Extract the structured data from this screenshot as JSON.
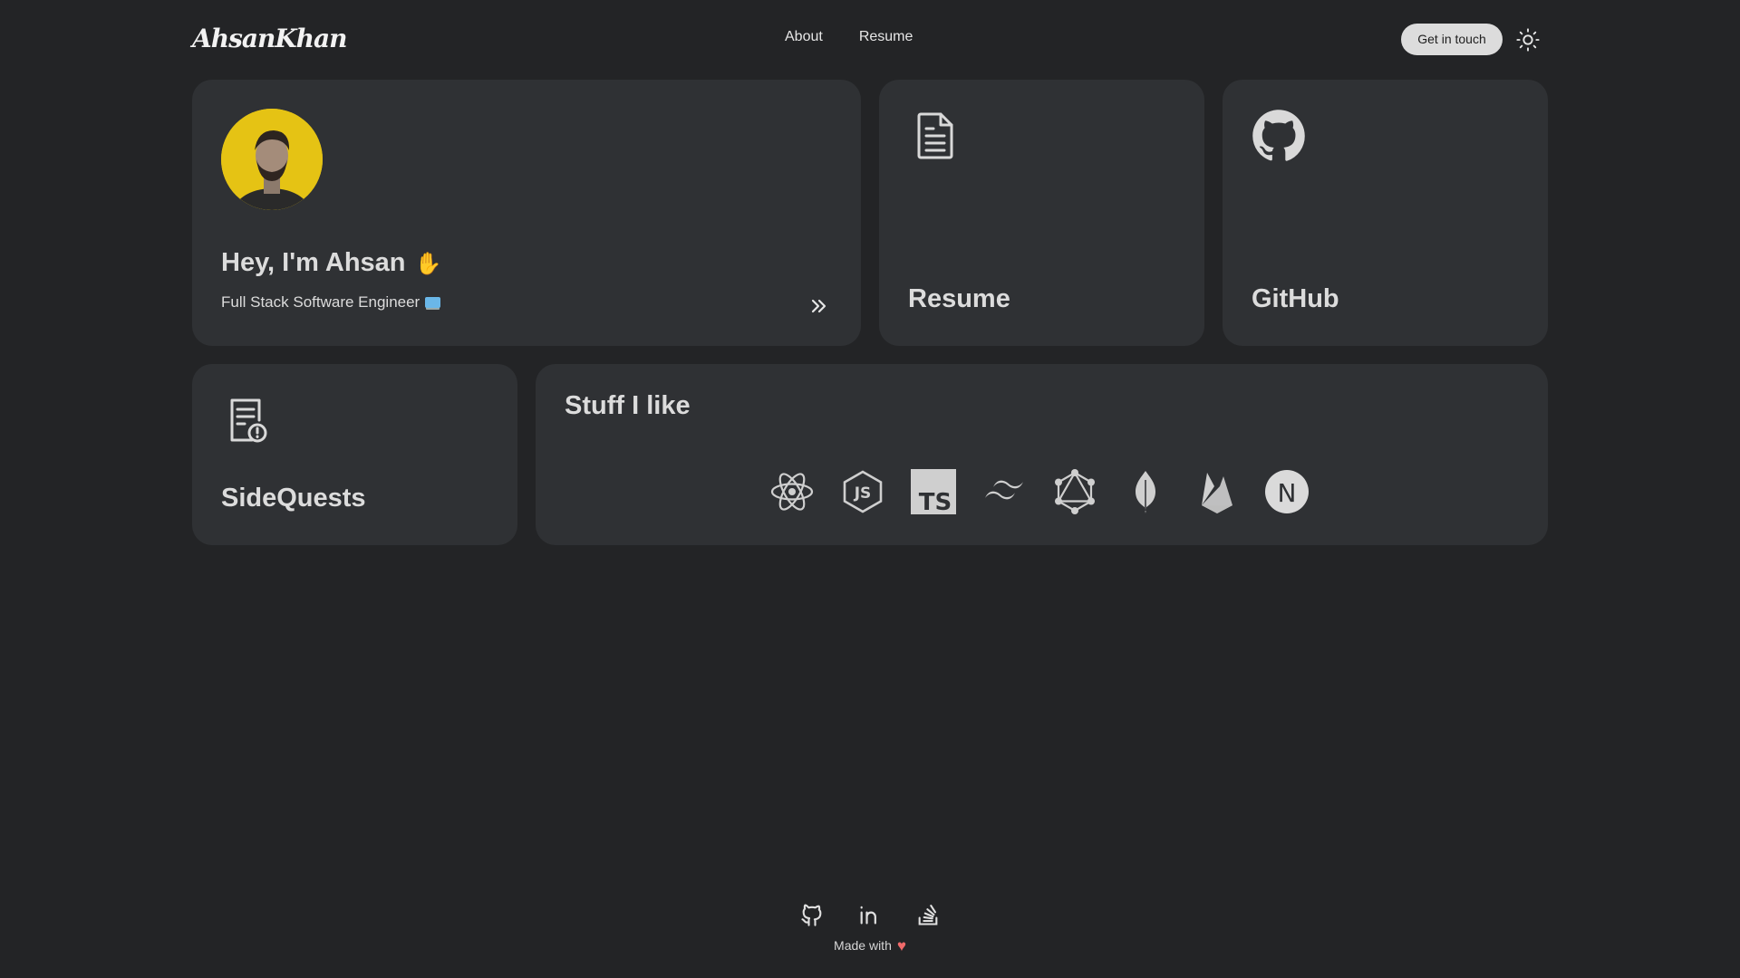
{
  "header": {
    "logo": "AhsanKhan",
    "nav": [
      "About",
      "Resume"
    ],
    "cta": "Get in touch",
    "theme_icon": "sun-icon"
  },
  "intro": {
    "greeting": "Hey, I'm Ahsan",
    "greeting_emoji": "✋",
    "subtitle": "Full Stack Software Engineer",
    "avatar_bg": "#e5c314"
  },
  "cards": {
    "resume": "Resume",
    "github": "GitHub",
    "sidequests": "SideQuests",
    "stuff": "Stuff I like"
  },
  "tech_icons": [
    "react-icon",
    "nodejs-icon",
    "typescript-icon",
    "tailwind-icon",
    "graphql-icon",
    "mongodb-icon",
    "firebase-icon",
    "nextjs-icon"
  ],
  "tech_labels": {
    "typescript": "TS",
    "nextjs": "N",
    "nodejs": "JS"
  },
  "footer": {
    "social": [
      "github-icon",
      "linkedin-icon",
      "stackoverflow-icon"
    ],
    "made_with": "Made with",
    "heart": "♥"
  },
  "colors": {
    "background": "#232426",
    "card": "#2f3134",
    "text": "#dcdcdc",
    "accent": "#e5c314"
  }
}
